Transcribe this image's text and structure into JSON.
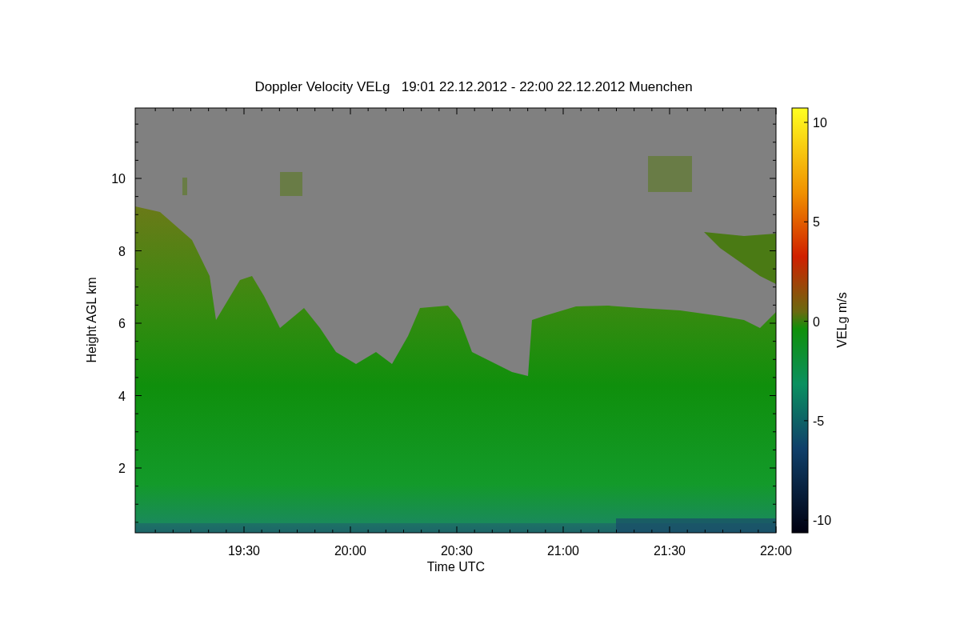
{
  "title": "Doppler Velocity VELg   19:01 22.12.2012 - 22:00 22.12.2012 Muenchen",
  "y_axis": {
    "label": "Height AGL km",
    "ticks": [
      "10",
      "8",
      "6",
      "4",
      "2"
    ]
  },
  "x_axis": {
    "label": "Time UTC",
    "ticks": [
      "19:30",
      "20:00",
      "20:30",
      "21:00",
      "21:30",
      "22:00"
    ]
  },
  "colorbar": {
    "label": "VELg m/s",
    "ticks": [
      "10",
      "5",
      "0",
      "-5",
      "-10"
    ]
  }
}
